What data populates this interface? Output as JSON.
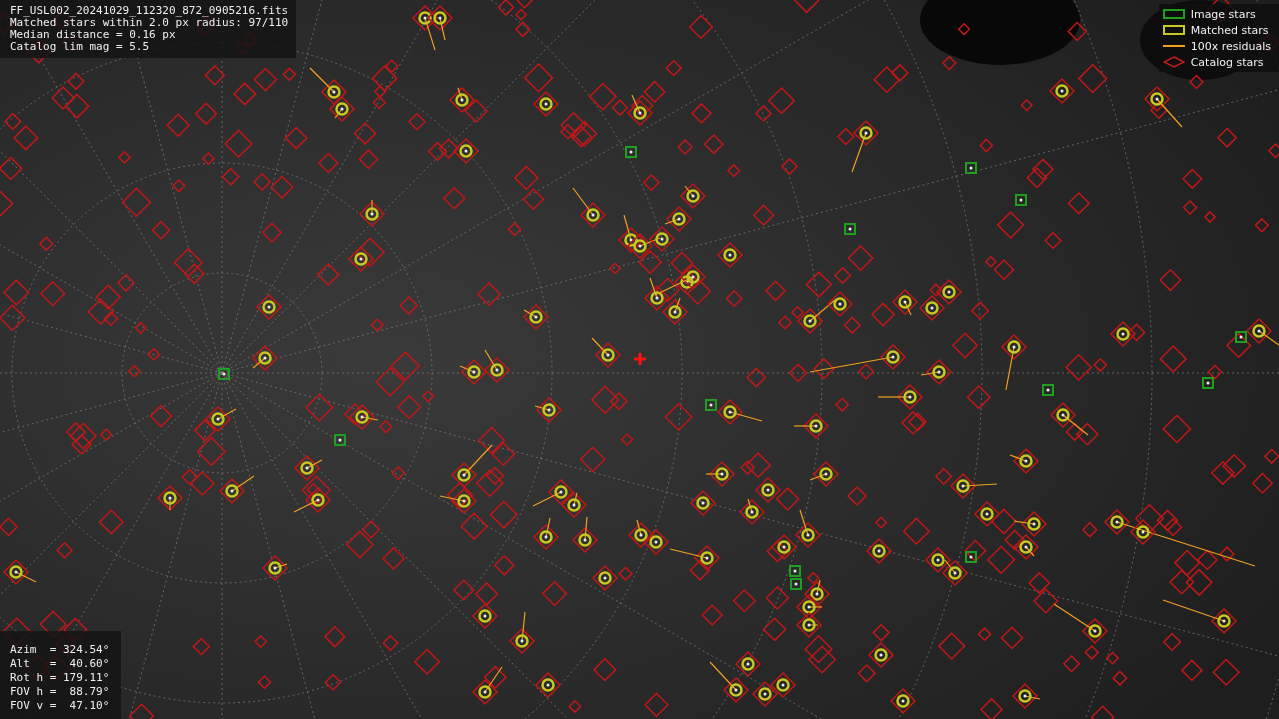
{
  "info": {
    "lines": [
      "FF_USL002_20241029_112320_872_0905216.fits",
      "Matched stars within 2.0 px radius: 97/110",
      "Median distance = 0.16 px",
      "Catalog lim mag = 5.5"
    ]
  },
  "legend": [
    {
      "kind": "image",
      "label": "Image stars",
      "color": "#1f9e1f"
    },
    {
      "kind": "matched",
      "label": "Matched stars",
      "color": "#c8c820"
    },
    {
      "kind": "residual",
      "label": "100x residuals",
      "color": "#f0a020"
    },
    {
      "kind": "catalog",
      "label": "Catalog stars",
      "color": "#c81e1e"
    }
  ],
  "pointing": {
    "lines": [
      "Azim  = 324.54°",
      "Alt   =  40.60°",
      "Rot h = 179.11°",
      "FOV h =  88.79°",
      "FOV v =  47.10°"
    ]
  }
}
